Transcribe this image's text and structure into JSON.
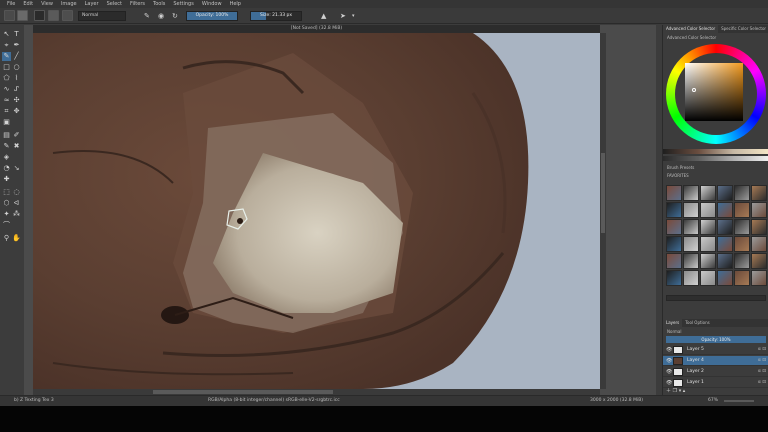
{
  "menu": [
    "File",
    "Edit",
    "View",
    "Image",
    "Layer",
    "Select",
    "Filters",
    "Tools",
    "Settings",
    "Window",
    "Help"
  ],
  "toolbar": {
    "blend_mode": "Normal",
    "opacity": {
      "label": "Opacity:",
      "value": "100%",
      "fraction": 1.0
    },
    "size": {
      "label": "Size:",
      "value": "21.33 px",
      "fraction": 0.3
    }
  },
  "canvas": {
    "document_title": "[Not Saved] (32.8 MiB)",
    "painting_description_colors": {
      "background": "#a9b4c2",
      "fur": "#5a3e31",
      "muzzle": "#cfc8b8"
    }
  },
  "dock": {
    "color_tabs": [
      "Advanced Color Selector",
      "Specific Color Selector"
    ],
    "color_sub_label": "Advanced Color Selector",
    "brush_presets_label": "Brush Presets",
    "brush_tag": "FAVORITES",
    "layer_tabs": [
      "Layers",
      "Tool Options"
    ],
    "layer_blend": "Normal",
    "layer_opacity": "Opacity: 100%",
    "layers": [
      {
        "name": "Layer 5",
        "selected": false
      },
      {
        "name": "Layer 4",
        "selected": true
      },
      {
        "name": "Layer 2",
        "selected": false
      },
      {
        "name": "Layer 1",
        "selected": false
      }
    ]
  },
  "status": {
    "brush": "b) Z Texting Tex 3",
    "color_space": "RGB/Alpha (8-bit integer/channel)  sRGB-elle-V2-srgbtrc.icc",
    "dimensions": "3000 x 2000 (32.8 MiB)",
    "zoom": "67%"
  }
}
